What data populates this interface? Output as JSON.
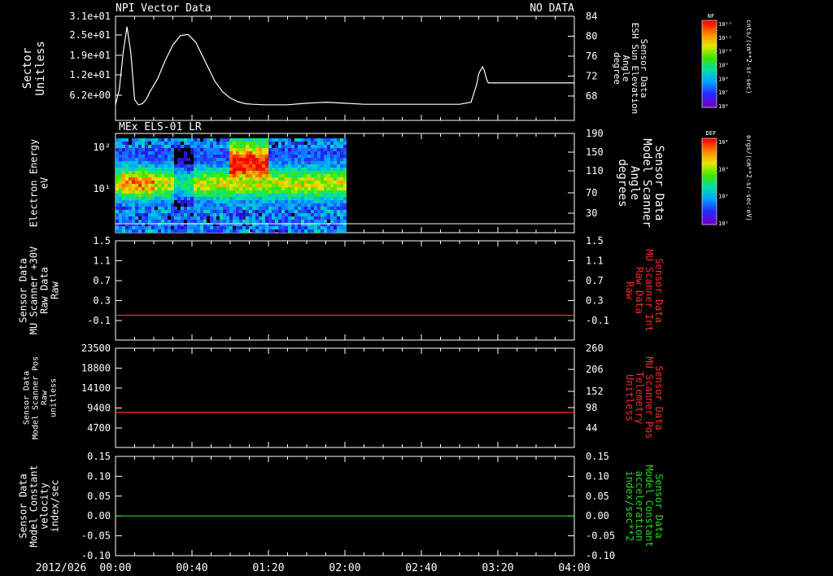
{
  "header": {
    "title": "NPI Vector Data",
    "status": "NO DATA"
  },
  "x_axis": {
    "date": "2012/026",
    "ticks": [
      "00:00",
      "00:40",
      "01:20",
      "02:00",
      "02:40",
      "03:20",
      "04:00"
    ],
    "xlim_min": [
      0,
      240
    ]
  },
  "chart_data": [
    {
      "type": "line",
      "panel": "sector",
      "left_label": [
        "Sector",
        "Unitless"
      ],
      "right_label": [
        "Sensor Data",
        "ESH Sun Elevation",
        "Angle",
        "degree"
      ],
      "left_ticks": [
        "3.1e+01",
        "2.5e+01",
        "1.9e+01",
        "1.2e+01",
        "6.2e+00"
      ],
      "right_ticks": [
        "84",
        "80",
        "76",
        "72",
        "68"
      ],
      "ylim_right": [
        64,
        84
      ],
      "x": [
        0,
        2,
        4,
        6,
        8,
        10,
        12,
        14,
        16,
        18,
        22,
        26,
        30,
        34,
        38,
        42,
        44,
        46,
        48,
        50,
        52,
        56,
        60,
        64,
        68,
        72,
        78,
        84,
        90,
        100,
        110,
        120,
        130,
        140,
        150,
        160,
        170,
        180,
        186,
        189,
        190,
        192,
        193,
        194,
        195,
        200,
        210,
        220,
        230,
        240
      ],
      "y": [
        67,
        70,
        77,
        82,
        77,
        68,
        67,
        67.2,
        68,
        69.5,
        72,
        75.5,
        78.5,
        80.3,
        80.5,
        79,
        77.5,
        76,
        74.5,
        73,
        71.5,
        69.5,
        68.3,
        67.6,
        67.2,
        67.1,
        67,
        67,
        67,
        67.3,
        67.5,
        67.3,
        67.1,
        67.1,
        67.1,
        67.1,
        67.1,
        67.1,
        67.5,
        71,
        73,
        74.3,
        73.5,
        72,
        71.2,
        71.2,
        71.2,
        71.2,
        71.2,
        71.2
      ],
      "line_color": "#ffffff"
    },
    {
      "type": "heatmap",
      "panel": "els",
      "title": "MEx ELS-01 LR",
      "left_label": [
        "Electron Energy",
        "eV"
      ],
      "left_ticks": [
        "10²",
        "10¹"
      ],
      "right_label": [
        "Sensor Data",
        "Model Scanner",
        "Angle",
        "degrees"
      ],
      "right_ticks": [
        "190",
        "150",
        "110",
        "70",
        "30"
      ],
      "data_end_minute": 120,
      "colorbar": {
        "label": "DEF",
        "units": "ergs/(cm**2-sr-sec-eV)",
        "ticks": [
          "10⁴",
          "10³",
          "10²",
          "10¹"
        ]
      },
      "scanner_line_value": 10
    },
    {
      "type": "line",
      "panel": "scanner30v",
      "left_label": [
        "Sensor Data",
        "MU Scanner +30V",
        "Raw Data",
        "Raw"
      ],
      "right_label": [
        "Sensor Data",
        "MU Scanner Int",
        "Raw Data",
        "Raw"
      ],
      "left_ticks": [
        "1.5",
        "1.1",
        "0.7",
        "0.3",
        "-0.1"
      ],
      "right_ticks": [
        "1.5",
        "1.1",
        "0.7",
        "0.3",
        "-0.1"
      ],
      "ylim": [
        -0.5,
        1.5
      ],
      "constant_value": 0,
      "line_color": "#ff2a2a"
    },
    {
      "type": "line",
      "panel": "scannerpos",
      "left_label": [
        "Sensor Data",
        "Model Scanner Pos",
        "Raw",
        "unitless"
      ],
      "right_label": [
        "Sensor Data",
        "MU Scanner Pos",
        "Telemetry",
        "Unitless"
      ],
      "left_ticks": [
        "23500",
        "18800",
        "14100",
        "9400",
        "4700"
      ],
      "right_ticks": [
        "260",
        "206",
        "152",
        "98",
        "44"
      ],
      "ylim": [
        0,
        23500
      ],
      "constant_value": 8300,
      "line_color": "#ff2a2a"
    },
    {
      "type": "line",
      "panel": "constant",
      "left_label": [
        "Sensor Data",
        "Model Constant",
        "velocity",
        "index/sec"
      ],
      "right_label": [
        "Sensor Data",
        "Model Constant",
        "acceleration",
        "index/sec**2"
      ],
      "left_ticks": [
        "0.15",
        "0.10",
        "0.05",
        "0.00",
        "-0.05",
        "-0.10"
      ],
      "right_ticks": [
        "0.15",
        "0.10",
        "0.05",
        "0.00",
        "-0.05",
        "-0.10"
      ],
      "ylim": [
        -0.1,
        0.15
      ],
      "constant_value": 0,
      "line_color": "#22dd22"
    }
  ],
  "colorbar_nf": {
    "label": "NF",
    "units": "cnts/(cm**2-sr-sec)",
    "ticks": [
      "10¹²",
      "10¹¹",
      "10¹⁰",
      "10⁹",
      "10⁸",
      "10⁷",
      "10⁶"
    ]
  },
  "colors": {
    "white": "#ffffff",
    "red": "#ff2a2a",
    "green": "#22dd22",
    "bg": "#000000"
  }
}
